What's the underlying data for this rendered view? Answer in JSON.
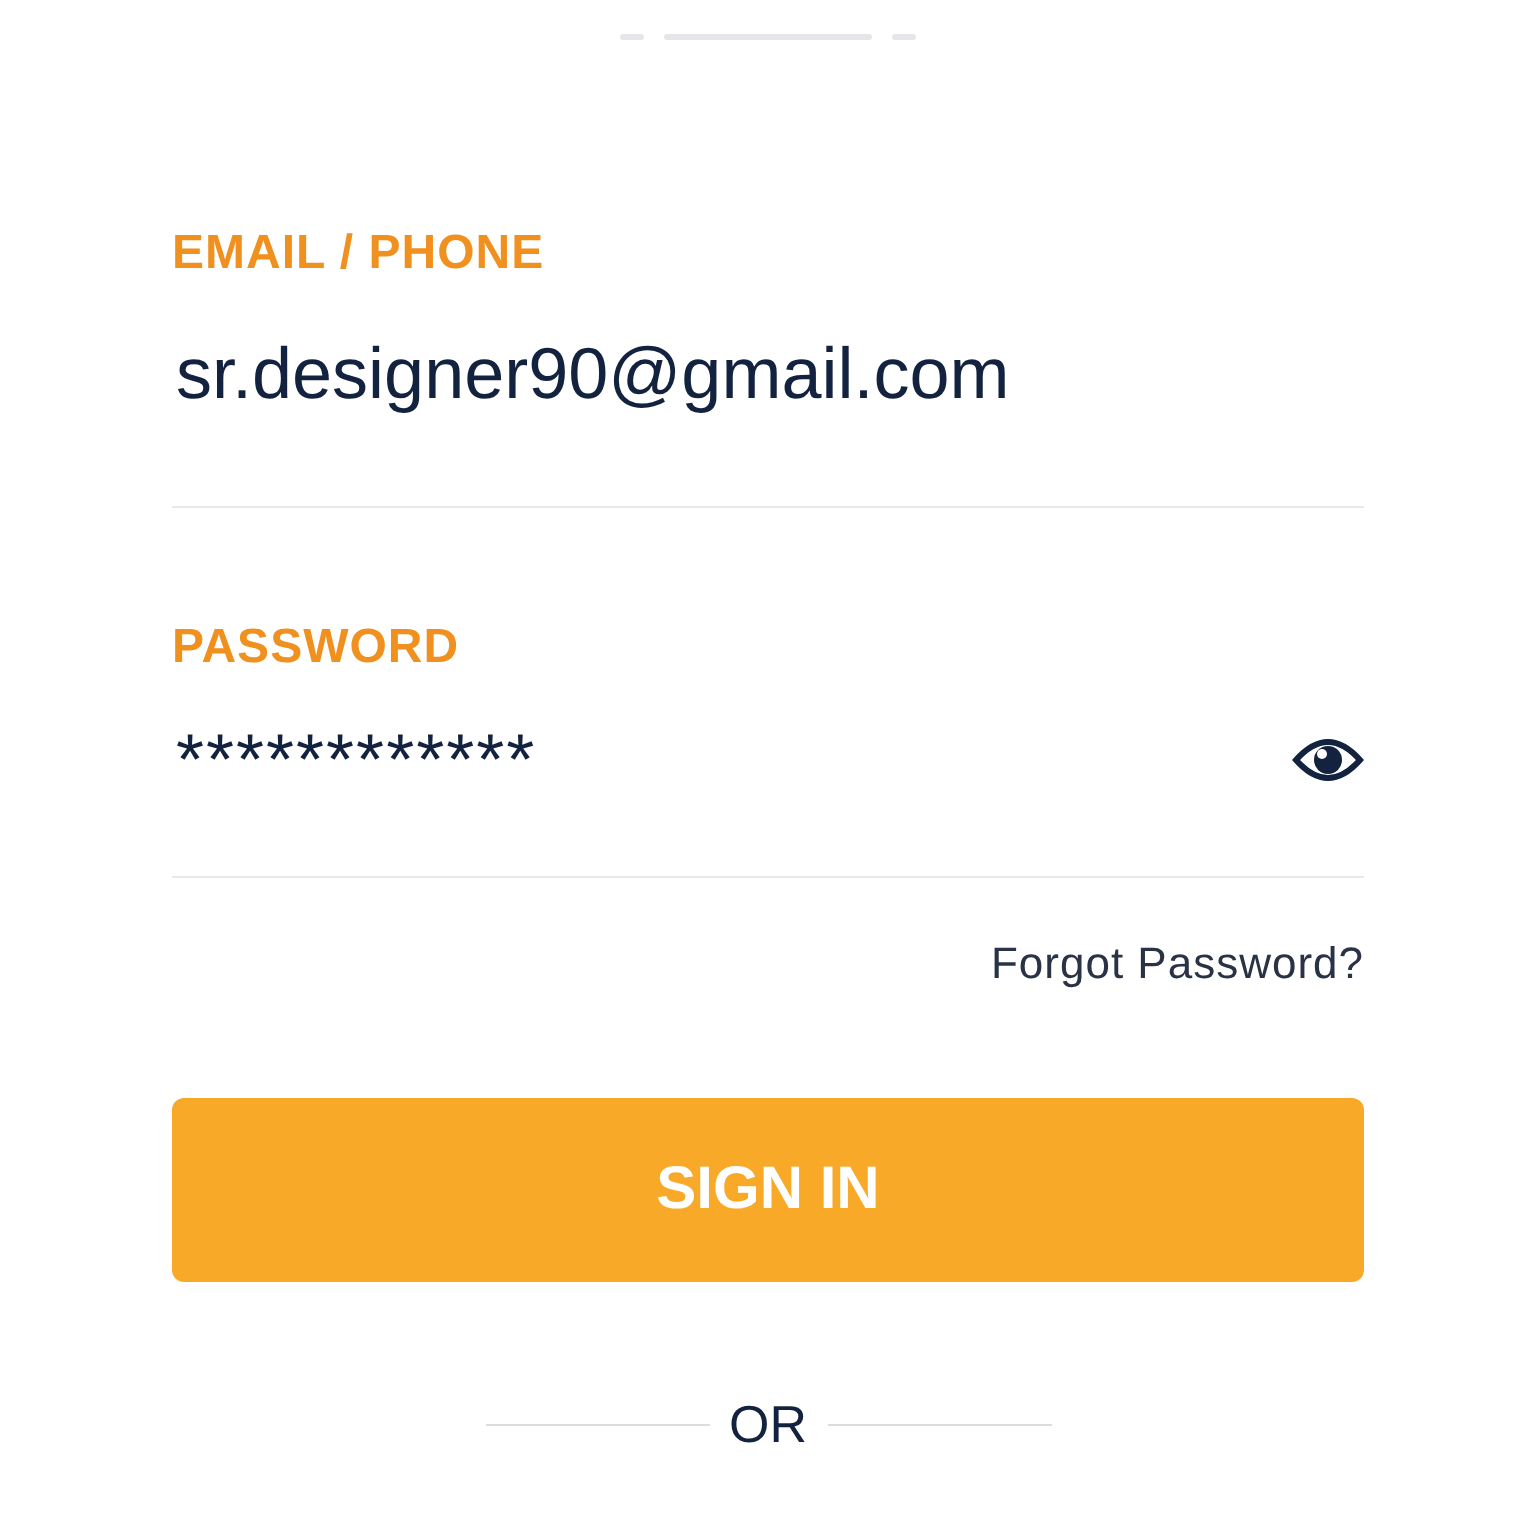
{
  "page_indicator": [
    {
      "selected": false
    },
    {
      "selected": true
    },
    {
      "selected": false
    }
  ],
  "email": {
    "label": "EMAIL / PHONE",
    "value": "sr.designer90@gmail.com"
  },
  "password": {
    "label": "PASSWORD",
    "value": "************"
  },
  "forgot_link": "Forgot Password?",
  "sign_in_button": "SIGN IN",
  "divider_text": "OR"
}
